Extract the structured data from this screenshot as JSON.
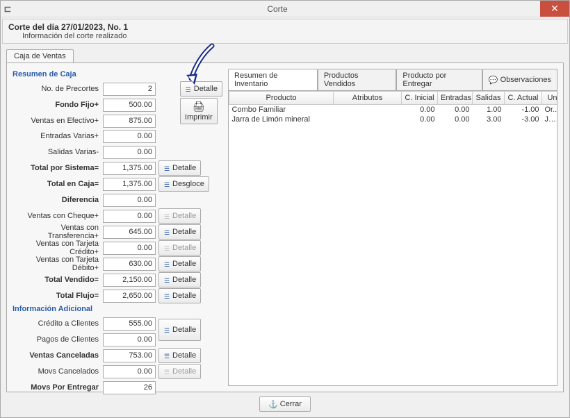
{
  "window": {
    "title": "Corte",
    "close_tooltip": "Cerrar"
  },
  "header": {
    "title": "Corte del día 27/01/2023, No. 1",
    "subtitle": "Información del corte realizado"
  },
  "main_tab": {
    "label": "Caja de Ventas"
  },
  "section_resumen": "Resumen de Caja",
  "section_info": "Información Adicional",
  "labels": {
    "precortes": "No. de Precortes",
    "fondo_fijo": "Fondo Fijo+",
    "ventas_efectivo": "Ventas en Efectivo+",
    "entradas_varias": "Entradas Varias+",
    "salidas_varias": "Salidas Varias-",
    "total_sistema": "Total por Sistema=",
    "total_caja": "Total en Caja=",
    "diferencia": "Diferencia",
    "ventas_cheque": "Ventas con Cheque+",
    "ventas_transf": "Ventas con Transferencia+",
    "ventas_tcredito": "Ventas con Tarjeta Crédito+",
    "ventas_tdebito": "Ventas con Tarjeta Débito+",
    "total_vendido": "Total Vendido=",
    "total_flujo": "Total Flujo=",
    "credito_clientes": "Crédito a Clientes",
    "pagos_clientes": "Pagos de Clientes",
    "ventas_canceladas": "Ventas Canceladas",
    "movs_cancelados": "Movs Cancelados",
    "movs_por_entregar": "Movs Por Entregar"
  },
  "values": {
    "precortes": "2",
    "fondo_fijo": "500.00",
    "ventas_efectivo": "875.00",
    "entradas_varias": "0.00",
    "salidas_varias": "0.00",
    "total_sistema": "1,375.00",
    "total_caja": "1,375.00",
    "diferencia": "0.00",
    "ventas_cheque": "0.00",
    "ventas_transf": "645.00",
    "ventas_tcredito": "0.00",
    "ventas_tdebito": "630.00",
    "total_vendido": "2,150.00",
    "total_flujo": "2,650.00",
    "credito_clientes": "555.00",
    "pagos_clientes": "0.00",
    "ventas_canceladas": "753.00",
    "movs_cancelados": "0.00",
    "movs_por_entregar": "26"
  },
  "buttons": {
    "detalle": "Detalle",
    "desgloce": "Desgloce",
    "imprimir": "Imprimir",
    "cerrar": "Cerrar"
  },
  "inner_tabs": {
    "resumen_inventario": "Resumen de Inventario",
    "productos_vendidos": "Productos Vendidos",
    "producto_por_entregar": "Producto por Entregar",
    "observaciones": "Observaciones"
  },
  "grid": {
    "headers": {
      "producto": "Producto",
      "atributos": "Atributos",
      "c_inicial": "C. Inicial",
      "entradas": "Entradas",
      "salidas": "Salidas",
      "c_actual": "C. Actual",
      "un": "Un"
    },
    "rows": [
      {
        "producto": "Combo Familiar",
        "atributos": "",
        "c_inicial": "0.00",
        "entradas": "0.00",
        "salidas": "1.00",
        "c_actual": "-1.00",
        "un": "Or..."
      },
      {
        "producto": "Jarra de Limón mineral",
        "atributos": "",
        "c_inicial": "0.00",
        "entradas": "0.00",
        "salidas": "3.00",
        "c_actual": "-3.00",
        "un": "Jarra"
      }
    ]
  }
}
